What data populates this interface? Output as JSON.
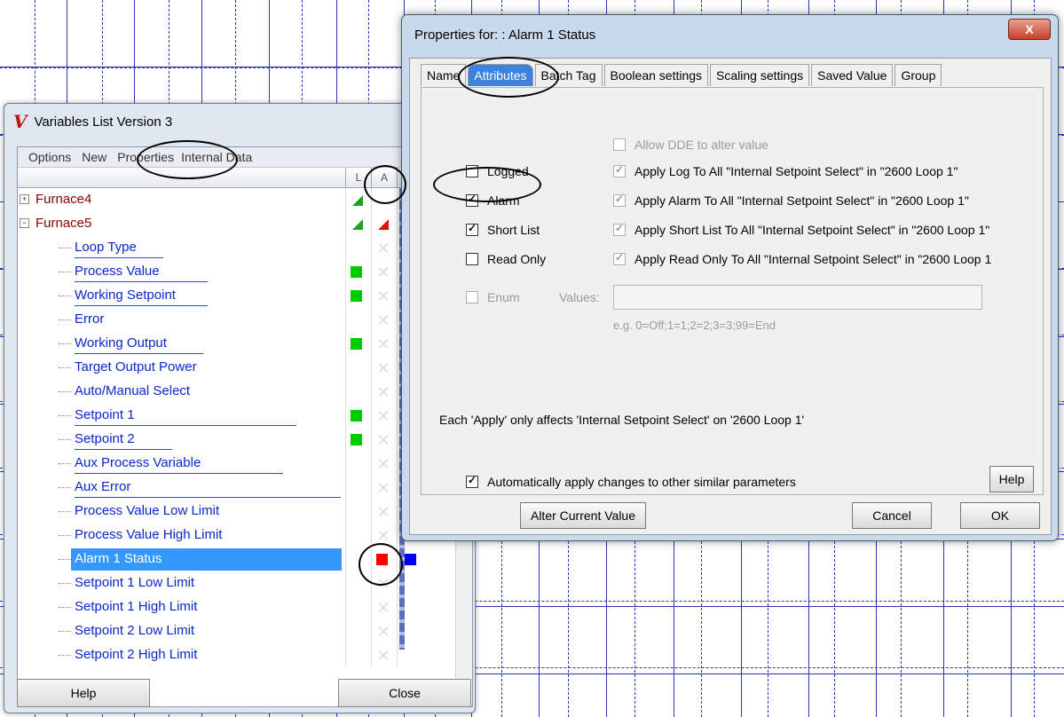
{
  "variables_window": {
    "title": "Variables List Version 3",
    "logo": "V",
    "menu": [
      "Options",
      "New",
      "Properties",
      "Internal Data"
    ],
    "col_l": "L",
    "col_a": "A",
    "groups": [
      "Furnace4",
      "Furnace5"
    ],
    "items": [
      {
        "label": "Loop Type"
      },
      {
        "label": "Process Value"
      },
      {
        "label": "Working Setpoint"
      },
      {
        "label": "Error"
      },
      {
        "label": "Working Output"
      },
      {
        "label": "Target Output Power"
      },
      {
        "label": "Auto/Manual Select"
      },
      {
        "label": "Setpoint 1"
      },
      {
        "label": "Setpoint 2"
      },
      {
        "label": "Aux Process Variable"
      },
      {
        "label": "Aux Error"
      },
      {
        "label": "Process Value Low Limit"
      },
      {
        "label": "Process Value High Limit"
      },
      {
        "label": "Alarm 1 Status"
      },
      {
        "label": "Setpoint 1 Low Limit"
      },
      {
        "label": "Setpoint 1 High Limit"
      },
      {
        "label": "Setpoint 2 Low Limit"
      },
      {
        "label": "Setpoint 2 High Limit"
      }
    ],
    "help_label": "Help",
    "close_label": "Close"
  },
  "properties_dialog": {
    "title": "Properties for: : Alarm 1 Status",
    "close_glyph": "X",
    "tabs": [
      "Name",
      "Attributes",
      "Batch Tag",
      "Boolean settings",
      "Scaling settings",
      "Saved Value",
      "Group"
    ],
    "allow_dde": "Allow DDE to alter value",
    "logged": "Logged",
    "alarm": "Alarm",
    "short_list": "Short List",
    "read_only": "Read Only",
    "enum": "Enum",
    "apply_log": "Apply Log To All \"Internal Setpoint Select\" in \"2600 Loop 1\"",
    "apply_alarm": "Apply Alarm To All \"Internal Setpoint Select\" in \"2600 Loop 1\"",
    "apply_short": "Apply Short List To All \"Internal Setpoint Select\" in \"2600 Loop 1\"",
    "apply_read": "Apply Read Only To All \"Internal Setpoint Select\" in \"2600 Loop 1",
    "values_label": "Values:",
    "values_hint": "e.g. 0=Off;1=1;2=2;3=3;99=End",
    "note": "Each 'Apply' only affects 'Internal Setpoint Select'  on '2600 Loop 1'",
    "auto_apply": "Automatically apply changes to other similar parameters",
    "help_label": "Help",
    "alter_label": "Alter Current Value",
    "cancel_label": "Cancel",
    "ok_label": "OK"
  }
}
